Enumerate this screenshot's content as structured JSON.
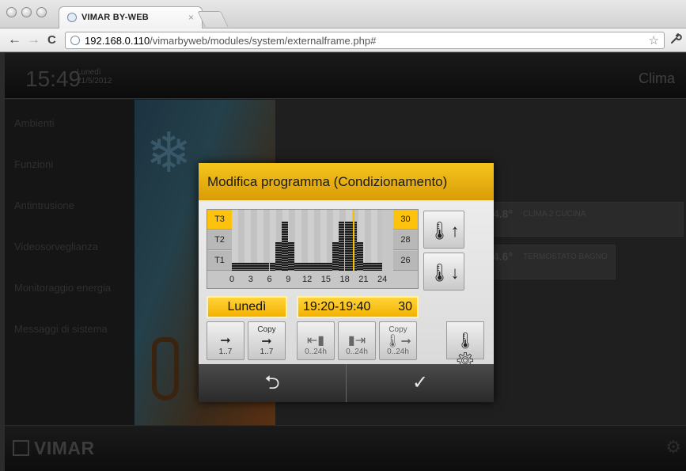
{
  "browser": {
    "tab_title": "VIMAR BY-WEB",
    "tab_close": "×",
    "url_host": "192.168.0.110",
    "url_path": "/vimarbyweb/modules/system/externalframe.php#",
    "back": "←",
    "forward": "→",
    "reload": "C",
    "star": "☆",
    "wrench": "🔧"
  },
  "header": {
    "time": "15:49",
    "day": "Lunedì",
    "date": "21/5/2012",
    "section": "Clima"
  },
  "sidebar": {
    "items": [
      {
        "label": "Ambienti"
      },
      {
        "label": "Funzioni"
      },
      {
        "label": "Antintrusione"
      },
      {
        "label": "Videosorveglianza"
      },
      {
        "label": "Monitoraggio energia"
      },
      {
        "label": "Messaggi di sistema"
      }
    ]
  },
  "clima_cards": [
    {
      "temp": "4.8°",
      "label": "CLIMA 2 CUCINA"
    },
    {
      "temp": "4.6°",
      "label": "TERMOSTATO BAGNO"
    }
  ],
  "footer": {
    "brand": "VIMAR"
  },
  "modal": {
    "title": "Modifica programma (Condizionamento)",
    "levels_left": [
      "T3",
      "T2",
      "T1"
    ],
    "levels_right": [
      "30",
      "28",
      "26"
    ],
    "active_level": "T3",
    "x_ticks": [
      "0",
      "3",
      "6",
      "9",
      "12",
      "15",
      "18",
      "21",
      "24"
    ],
    "day_label": "Lunedì",
    "time_range": "19:20-19:40",
    "time_value": "30",
    "copy_label": "Copy",
    "btn_day_range": "1..7",
    "btn_hour_range": "0..24h",
    "ok_symbol": "✓",
    "back_symbol": "⮌",
    "colors": {
      "accent": "#F5B800",
      "header": "#E0A50A"
    }
  },
  "chart_data": {
    "type": "bar",
    "title": "",
    "xlabel": "",
    "ylabel": "",
    "x": [
      0,
      1,
      2,
      3,
      4,
      5,
      6,
      7,
      8,
      9,
      10,
      11,
      12,
      13,
      14,
      15,
      16,
      17,
      18,
      19,
      20,
      21,
      22,
      23
    ],
    "values": [
      1,
      1,
      1,
      1,
      1,
      1,
      1,
      2,
      3,
      2,
      1,
      1,
      1,
      1,
      1,
      1,
      2,
      3,
      3,
      3,
      2,
      1,
      1,
      1
    ],
    "y_levels": [
      "T1",
      "T2",
      "T3"
    ],
    "xlim": [
      0,
      24
    ],
    "current_time": 19.33
  }
}
